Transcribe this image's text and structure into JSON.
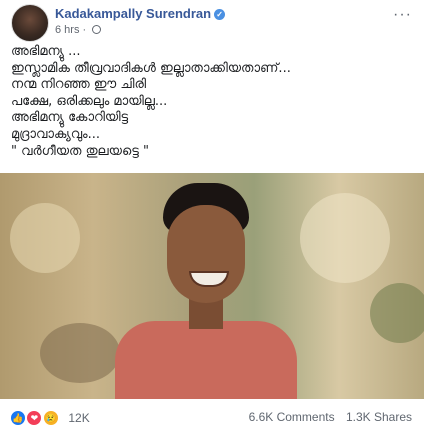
{
  "post": {
    "author": "Kadakampally Surendran",
    "time": "6 hrs",
    "separator": "·",
    "more": "···",
    "verified_mark": "✓",
    "lines": [
      "അഭിമന്യു ...",
      "ഇസ്ലാമിക തീവ്രവാദികൾ ഇല്ലാതാക്കിയതാണ്...",
      "നന്മ നിറഞ്ഞ ഈ ചിരി",
      "പക്ഷേ, ഒരിക്കലും മായില്ല...",
      "അഭിമന്യു കോറിയിട്ട",
      "മുദ്രാവാക്യവും...",
      "\" വർഗീയത തുലയട്ടെ \""
    ]
  },
  "stats": {
    "reactions_count": "12K",
    "comments": "6.6K Comments",
    "shares": "1.3K Shares"
  },
  "icons": {
    "like": "👍",
    "love": "❤",
    "sad": "😢"
  },
  "colors": {
    "author_link": "#385898",
    "verified": "#4a90e2",
    "like": "#1877f2",
    "love": "#f33e58",
    "sad": "#f7b125"
  }
}
